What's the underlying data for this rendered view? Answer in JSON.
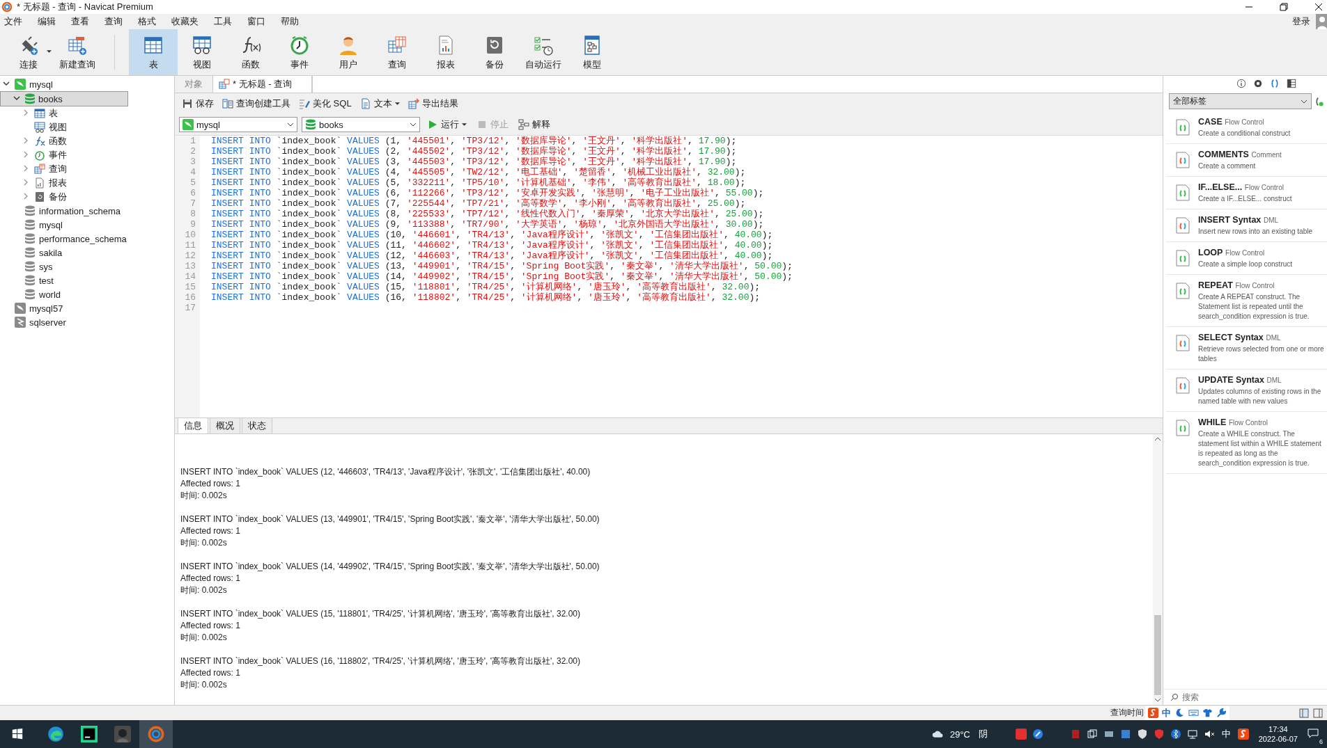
{
  "window": {
    "title": "* 无标题 - 查询 - Navicat Premium",
    "login": "登录"
  },
  "menu": [
    "文件",
    "编辑",
    "查看",
    "查询",
    "格式",
    "收藏夹",
    "工具",
    "窗口",
    "帮助"
  ],
  "toolbar": {
    "left": [
      {
        "label": "连接",
        "kind": "connect",
        "selected": false
      },
      {
        "label": "新建查询",
        "kind": "newquery",
        "selected": false
      }
    ],
    "objects": [
      {
        "label": "表",
        "kind": "table",
        "selected": true
      },
      {
        "label": "视图",
        "kind": "view",
        "selected": false
      },
      {
        "label": "函数",
        "kind": "function",
        "selected": false
      },
      {
        "label": "事件",
        "kind": "event",
        "selected": false
      },
      {
        "label": "用户",
        "kind": "user",
        "selected": false
      },
      {
        "label": "查询",
        "kind": "query",
        "selected": false
      },
      {
        "label": "报表",
        "kind": "report",
        "selected": false
      },
      {
        "label": "备份",
        "kind": "backup",
        "selected": false
      },
      {
        "label": "自动运行",
        "kind": "autorun",
        "selected": false
      },
      {
        "label": "模型",
        "kind": "model",
        "selected": false
      }
    ]
  },
  "tree": [
    {
      "label": "mysql",
      "kind": "connection",
      "expanded": true,
      "selected": false,
      "children": [
        {
          "label": "books",
          "kind": "database",
          "expanded": true,
          "selected": true,
          "children": [
            {
              "label": "表",
              "kind": "table",
              "expanded": false,
              "selected": false
            },
            {
              "label": "视图",
              "kind": "view",
              "selected": false
            },
            {
              "label": "函数",
              "kind": "function",
              "expanded": false,
              "selected": false
            },
            {
              "label": "事件",
              "kind": "event",
              "expanded": false,
              "selected": false
            },
            {
              "label": "查询",
              "kind": "query",
              "expanded": false,
              "selected": false
            },
            {
              "label": "报表",
              "kind": "report",
              "expanded": false,
              "selected": false
            },
            {
              "label": "备份",
              "kind": "backup",
              "expanded": false,
              "selected": false
            }
          ]
        },
        {
          "label": "information_schema",
          "kind": "database",
          "selected": false
        },
        {
          "label": "mysql",
          "kind": "database",
          "selected": false
        },
        {
          "label": "performance_schema",
          "kind": "database",
          "selected": false
        },
        {
          "label": "sakila",
          "kind": "database",
          "selected": false
        },
        {
          "label": "sys",
          "kind": "database",
          "selected": false
        },
        {
          "label": "test",
          "kind": "database",
          "selected": false
        },
        {
          "label": "world",
          "kind": "database",
          "selected": false
        }
      ]
    },
    {
      "label": "mysql57",
      "kind": "connection",
      "selected": false
    },
    {
      "label": "sqlserver",
      "kind": "sqlserver",
      "selected": false
    }
  ],
  "tabs": [
    {
      "label": "对象",
      "selected": false
    },
    {
      "label": "* 无标题 - 查询",
      "selected": true
    }
  ],
  "actions": [
    {
      "label": "保存",
      "kind": "save"
    },
    {
      "label": "查询创建工具",
      "kind": "builder"
    },
    {
      "label": "美化 SQL",
      "kind": "beautify"
    },
    {
      "label": "文本",
      "kind": "text"
    },
    {
      "label": "导出结果",
      "kind": "export"
    }
  ],
  "selectors": {
    "connection": "mysql",
    "database": "books"
  },
  "run": {
    "run": "运行",
    "stop": "停止",
    "stop_disabled": true,
    "explain": "解释"
  },
  "editor": [
    {
      "n": "1",
      "code": "INSERT INTO `index_book` VALUES (1, '445501', 'TP3/12', '数据库导论', '王文丹', '科学出版社', 17.90);"
    },
    {
      "n": "2",
      "code": "INSERT INTO `index_book` VALUES (2, '445502', 'TP3/12', '数据库导论', '王文丹', '科学出版社', 17.90);"
    },
    {
      "n": "3",
      "code": "INSERT INTO `index_book` VALUES (3, '445503', 'TP3/12', '数据库导论', '王文丹', '科学出版社', 17.90);"
    },
    {
      "n": "4",
      "code": "INSERT INTO `index_book` VALUES (4, '445505', 'TW2/12', '电工基础', '楚留香', '机械工业出版社', 32.00);"
    },
    {
      "n": "5",
      "code": "INSERT INTO `index_book` VALUES (5, '332211', 'TP5/10', '计算机基础', '李伟', '高等教育出版社', 18.00);"
    },
    {
      "n": "6",
      "code": "INSERT INTO `index_book` VALUES (6, '112266', 'TP3/12', '安卓开发实践', '张慧明', '电子工业出版社', 55.00);"
    },
    {
      "n": "7",
      "code": "INSERT INTO `index_book` VALUES (7, '225544', 'TP7/21', '高等数学', '李小刚', '高等教育出版社', 25.00);"
    },
    {
      "n": "8",
      "code": "INSERT INTO `index_book` VALUES (8, '225533', 'TP7/12', '线性代数入门', '秦厚荣', '北京大学出版社', 25.00);"
    },
    {
      "n": "9",
      "code": "INSERT INTO `index_book` VALUES (9, '113388', 'TR7/90', '大学英语', '杨琼', '北京外国语大学出版社', 30.00);"
    },
    {
      "n": "10",
      "code": "INSERT INTO `index_book` VALUES (10, '446601', 'TR4/13', 'Java程序设计', '张凯文', '工信集团出版社', 40.00);"
    },
    {
      "n": "11",
      "code": "INSERT INTO `index_book` VALUES (11, '446602', 'TR4/13', 'Java程序设计', '张凯文', '工信集团出版社', 40.00);"
    },
    {
      "n": "12",
      "code": "INSERT INTO `index_book` VALUES (12, '446603', 'TR4/13', 'Java程序设计', '张凯文', '工信集团出版社', 40.00);"
    },
    {
      "n": "13",
      "code": "INSERT INTO `index_book` VALUES (13, '449901', 'TR4/15', 'Spring Boot实践', '秦文举', '清华大学出版社', 50.00);"
    },
    {
      "n": "14",
      "code": "INSERT INTO `index_book` VALUES (14, '449902', 'TR4/15', 'Spring Boot实践', '秦文举', '清华大学出版社', 50.00);"
    },
    {
      "n": "15",
      "code": "INSERT INTO `index_book` VALUES (15, '118801', 'TR4/25', '计算机网络', '唐玉玲', '高等教育出版社', 32.00);"
    },
    {
      "n": "16",
      "code": "INSERT INTO `index_book` VALUES (16, '118802', 'TR4/25', '计算机网络', '唐玉玲', '高等教育出版社', 32.00);"
    },
    {
      "n": "17"
    }
  ],
  "result_tabs": [
    {
      "label": "信息",
      "selected": true
    },
    {
      "label": "概况",
      "selected": false
    },
    {
      "label": "状态",
      "selected": false
    }
  ],
  "messages": [
    {
      "sql": "INSERT INTO `index_book` VALUES (12, '446603', 'TR4/13', 'Java程序设计', '张凯文', '工信集团出版社', 40.00)",
      "rows": "Affected rows: 1",
      "time": "时间: 0.002s"
    },
    {
      "sql": "INSERT INTO `index_book` VALUES (13, '449901', 'TR4/15', 'Spring Boot实践', '秦文举', '清华大学出版社', 50.00)",
      "rows": "Affected rows: 1",
      "time": "时间: 0.002s"
    },
    {
      "sql": "INSERT INTO `index_book` VALUES (14, '449902', 'TR4/15', 'Spring Boot实践', '秦文举', '清华大学出版社', 50.00)",
      "rows": "Affected rows: 1",
      "time": "时间: 0.002s"
    },
    {
      "sql": "INSERT INTO `index_book` VALUES (15, '118801', 'TR4/25', '计算机网络', '唐玉玲', '高等教育出版社', 32.00)",
      "rows": "Affected rows: 1",
      "time": "时间: 0.002s"
    },
    {
      "sql": "INSERT INTO `index_book` VALUES (16, '118802', 'TR4/25', '计算机网络', '唐玉玲', '高等教育出版社', 32.00)",
      "rows": "Affected rows: 1",
      "time": "时间: 0.002s"
    }
  ],
  "snippets": {
    "filter": "全部标签",
    "search_placeholder": "搜索",
    "items": [
      {
        "title": "CASE",
        "category": "Flow Control",
        "description": "Create a conditional construct",
        "kind": "plain"
      },
      {
        "title": "COMMENTS",
        "category": "Comment",
        "description": "Create a comment",
        "kind": "colored"
      },
      {
        "title": "IF...ELSE...",
        "category": "Flow Control",
        "description": "Create a IF...ELSE... construct",
        "kind": "plain"
      },
      {
        "title": "INSERT Syntax",
        "category": "DML",
        "description": "Insert new rows into an existing table",
        "kind": "colored"
      },
      {
        "title": "LOOP",
        "category": "Flow Control",
        "description": "Create a simple loop construct",
        "kind": "plain"
      },
      {
        "title": "REPEAT",
        "category": "Flow Control",
        "description": "Create A REPEAT construct. The Statement list is repeated until the search_condition expression is true.",
        "kind": "plain"
      },
      {
        "title": "SELECT Syntax",
        "category": "DML",
        "description": "Retrieve rows selected from one or more tables",
        "kind": "colored"
      },
      {
        "title": "UPDATE Syntax",
        "category": "DML",
        "description": "Updates columns of existing rows in the named table with new values",
        "kind": "colored"
      },
      {
        "title": "WHILE",
        "category": "Flow Control",
        "description": "Create a WHILE construct. The statement list within a WHILE statement is repeated as long as the search_condition expression is true.",
        "kind": "plain"
      }
    ]
  },
  "status_bar": {
    "query_time": "查询时间",
    "ime": "中"
  },
  "taskbar": {
    "weather": "29°C",
    "condition": "阴",
    "ime": "中",
    "time": "17:34",
    "date": "2022-06-07",
    "notifications": "6"
  }
}
